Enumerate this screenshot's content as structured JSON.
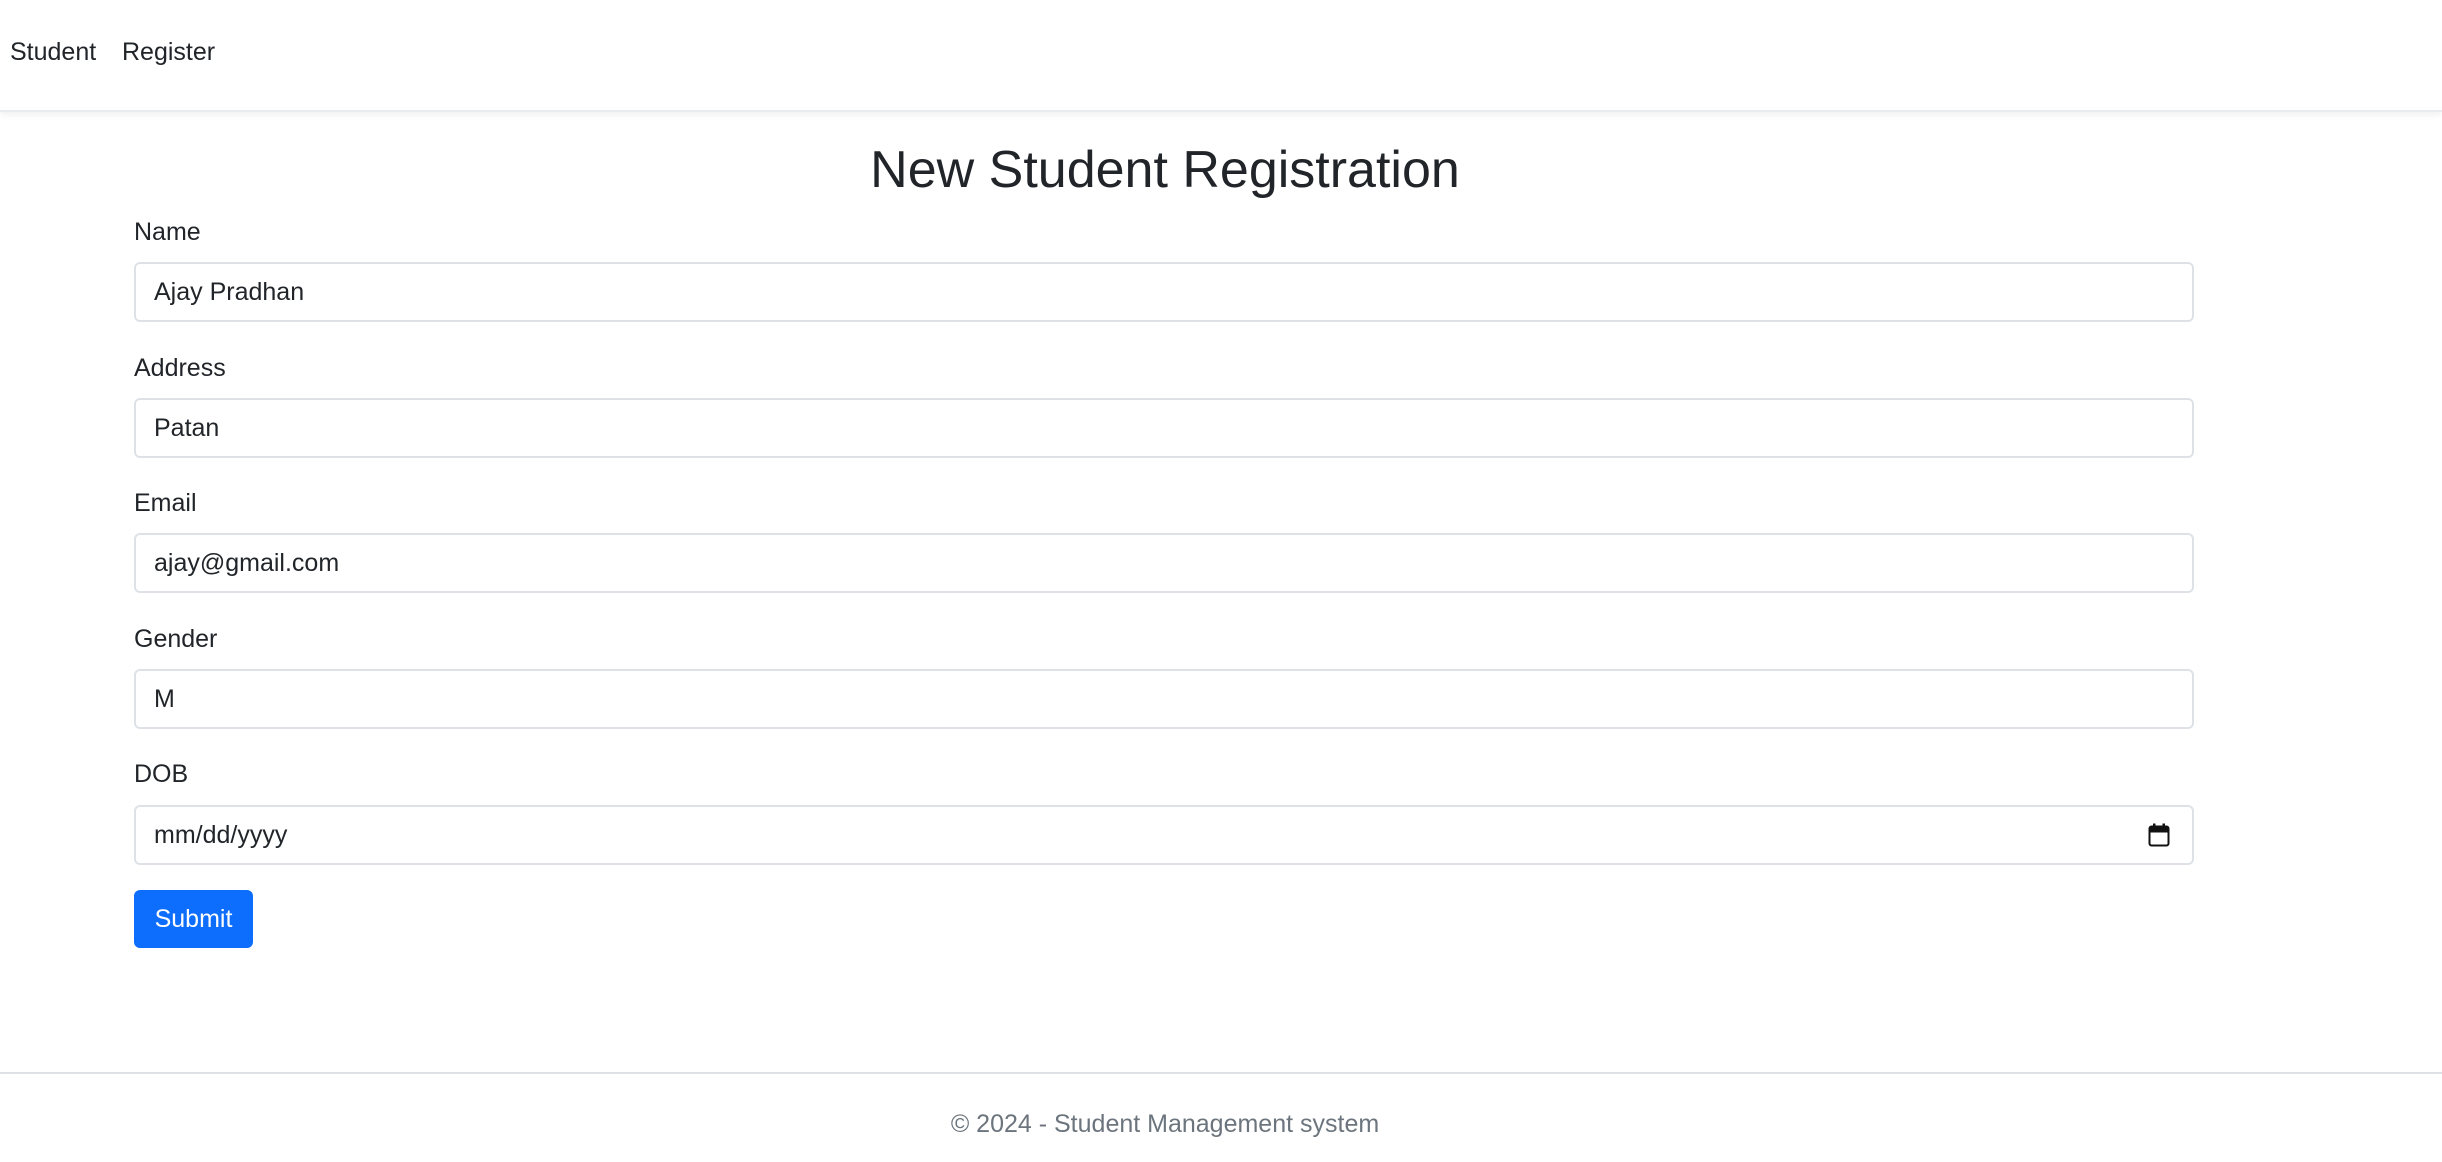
{
  "navbar": {
    "brand": "Student",
    "links": [
      "Register"
    ]
  },
  "page": {
    "title": "New Student Registration"
  },
  "form": {
    "name": {
      "label": "Name",
      "value": "Ajay Pradhan"
    },
    "address": {
      "label": "Address",
      "value": "Patan"
    },
    "email": {
      "label": "Email",
      "value": "ajay@gmail.com"
    },
    "gender": {
      "label": "Gender",
      "value": "M"
    },
    "dob": {
      "label": "DOB",
      "placeholder": "mm/dd/yyyy",
      "icon": "calendar-icon"
    },
    "submit_label": "Submit"
  },
  "footer": {
    "text": "© 2024 - Student Management system"
  },
  "colors": {
    "primary": "#0d6efd",
    "text": "#212529",
    "muted": "#6c757d",
    "border": "#dee2e6"
  }
}
